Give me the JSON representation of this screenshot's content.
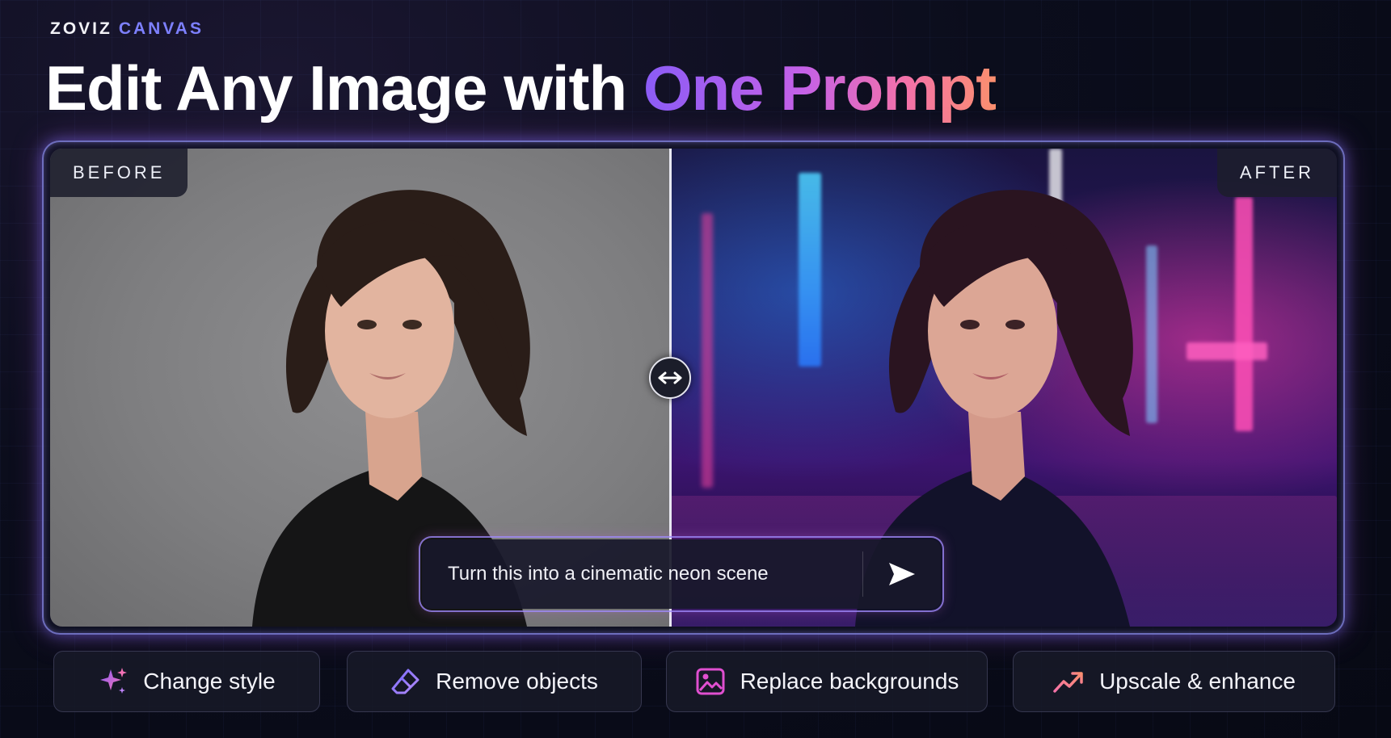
{
  "brand": {
    "name": "ZOVIZ",
    "product": "CANVAS"
  },
  "headline": {
    "plain": "Edit Any Image with ",
    "highlight": "One Prompt"
  },
  "comparison": {
    "before_label": "BEFORE",
    "after_label": "AFTER",
    "slider_icon": "left-right-arrows-icon"
  },
  "prompt": {
    "value": "Turn this into a cinematic neon scene",
    "send_icon": "send-icon"
  },
  "features": [
    {
      "label": "Change style",
      "icon": "sparkles-icon"
    },
    {
      "label": "Remove objects",
      "icon": "eraser-icon"
    },
    {
      "label": "Replace backgrounds",
      "icon": "image-icon"
    },
    {
      "label": "Upscale & enhance",
      "icon": "trending-up-icon"
    }
  ],
  "colors": {
    "accent_purple": "#8b5cf6",
    "accent_pink": "#f472a8",
    "accent_coral": "#fb8f6e",
    "brand_blue": "#7d80ff",
    "background": "#0b0d1c"
  }
}
